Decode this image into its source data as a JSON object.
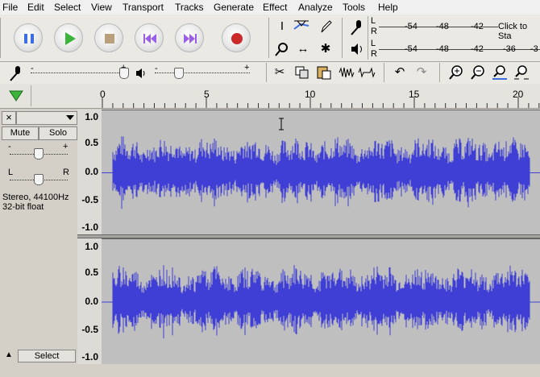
{
  "menu": [
    "File",
    "Edit",
    "Select",
    "View",
    "Transport",
    "Tracks",
    "Generate",
    "Effect",
    "Analyze",
    "Tools",
    "Help"
  ],
  "meters": {
    "record": {
      "l": "L",
      "r": "R",
      "ticks": [
        "-54",
        "-48",
        "-42"
      ],
      "hint": "Click to Sta"
    },
    "play": {
      "l": "L",
      "r": "R",
      "ticks": [
        "-54",
        "-48",
        "-42",
        "-36",
        "-3"
      ]
    }
  },
  "mixer": {
    "minus1": "-",
    "plus1": "+",
    "minus2": "-",
    "plus2": "+"
  },
  "ruler": {
    "labels": [
      "0",
      "5",
      "10",
      "15",
      "20"
    ]
  },
  "track": {
    "close": "×",
    "mute": "Mute",
    "solo": "Solo",
    "gain_minus": "-",
    "gain_plus": "+",
    "pan_left": "L",
    "pan_right": "R",
    "format_line1": "Stereo, 44100Hz",
    "format_line2": "32-bit float",
    "collapse": "▲",
    "select": "Select"
  },
  "vertical_scale": [
    "1.0",
    "0.5",
    "0.0",
    "-0.5",
    "-1.0"
  ],
  "colors": {
    "waveform": "#3f3fd6",
    "wave_bg": "#bfbfbf",
    "play_green": "#3cb43c",
    "record_red": "#cc2a2a",
    "pause_blue": "#3d6fe0",
    "skip_purple": "#9a5ee8",
    "stop_tan": "#b9a07c"
  }
}
